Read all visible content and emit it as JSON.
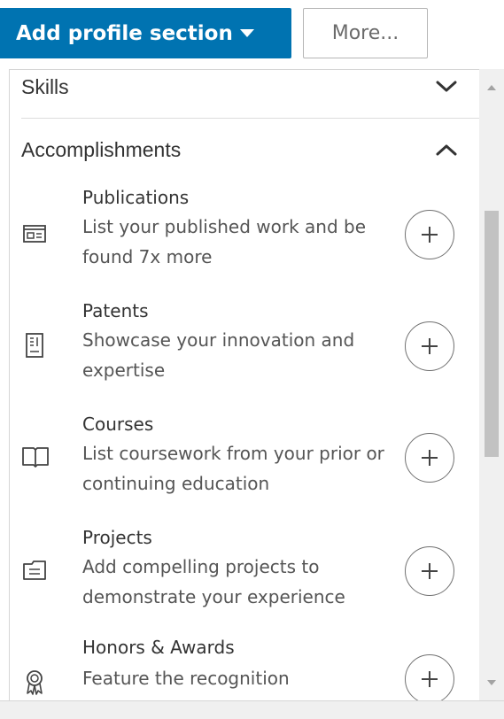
{
  "toolbar": {
    "add_section_label": "Add profile section",
    "more_label": "More..."
  },
  "sections": {
    "skills": {
      "title": "Skills",
      "state": "collapsed",
      "icon": "chevron-down-icon"
    },
    "accomplishments": {
      "title": "Accomplishments",
      "state": "expanded",
      "icon": "chevron-up-icon"
    }
  },
  "items": [
    {
      "name": "Publications",
      "desc": "List your published work and be found 7x more",
      "icon": "publication-icon"
    },
    {
      "name": "Patents",
      "desc": "Showcase your innovation and expertise",
      "icon": "patent-icon"
    },
    {
      "name": "Courses",
      "desc": "List coursework from your prior or continuing education",
      "icon": "book-icon"
    },
    {
      "name": "Projects",
      "desc": "Add compelling projects to demonstrate your experience",
      "icon": "folder-icon"
    },
    {
      "name": "Honors & Awards",
      "desc": "Feature the recognition",
      "icon": "award-icon"
    }
  ],
  "colors": {
    "primary": "#0073b1",
    "text": "#333333",
    "muted": "#555555",
    "border": "#d6d6d6",
    "scrollbar_track": "#f0f0f0",
    "scrollbar_thumb": "#c2c2c2"
  }
}
